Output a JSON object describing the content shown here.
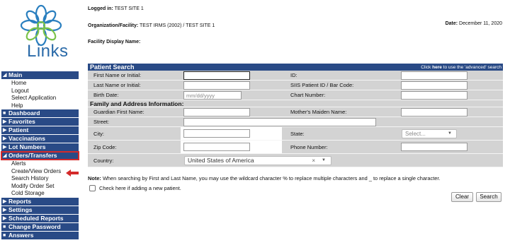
{
  "header": {
    "logged_in_label": "Logged in:",
    "logged_in_value": "TEST SITE 1",
    "org_label": "Organization/Facility:",
    "org_value": "TEST IRMS (2002) / TEST SITE 1",
    "facility_display_label": "Facility Display Name:",
    "date_label": "Date:",
    "date_value": "December 11, 2020"
  },
  "logo": {
    "text": "Links",
    "icon": "flower-logo"
  },
  "sidebar": {
    "sections": [
      {
        "label": "Main",
        "arrow": "◢",
        "items": [
          "Home",
          "Logout",
          "Select Application",
          "Help"
        ]
      },
      {
        "label": "Dashboard",
        "arrow": "■",
        "items": []
      },
      {
        "label": "Favorites",
        "arrow": "▶",
        "items": []
      },
      {
        "label": "Patient",
        "arrow": "▶",
        "items": []
      },
      {
        "label": "Vaccinations",
        "arrow": "▶",
        "items": []
      },
      {
        "label": "Lot Numbers",
        "arrow": "▶",
        "items": []
      },
      {
        "label": "Orders/Transfers",
        "arrow": "◢",
        "items": [
          "Alerts",
          "Create/View Orders",
          "Search History",
          "Modify Order Set",
          "Cold Storage"
        ]
      },
      {
        "label": "Reports",
        "arrow": "▶",
        "items": []
      },
      {
        "label": "Settings",
        "arrow": "▶",
        "items": []
      },
      {
        "label": "Scheduled Reports",
        "arrow": "▶",
        "items": []
      },
      {
        "label": "Change Password",
        "arrow": "■",
        "items": []
      },
      {
        "label": "Answers",
        "arrow": "■",
        "items": []
      }
    ]
  },
  "search": {
    "title": "Patient Search",
    "advanced_pre": "Click ",
    "advanced_link": "here",
    "advanced_post": " to use the 'advanced' search",
    "first_name_label": "First Name or Initial:",
    "id_label": "ID:",
    "last_name_label": "Last Name or Initial:",
    "siis_label": "SIIS Patient ID / Bar Code:",
    "birth_date_label": "Birth Date:",
    "birth_date_placeholder": "mm/dd/yyyy",
    "chart_number_label": "Chart Number:",
    "family_section": "Family and Address Information:",
    "guardian_label": "Guardian First Name:",
    "maiden_label": "Mother's Maiden Name:",
    "street_label": "Street:",
    "city_label": "City:",
    "state_label": "State:",
    "state_value": "Select...",
    "zip_label": "Zip Code:",
    "phone_label": "Phone Number:",
    "country_label": "Country:",
    "country_value": "United States of America",
    "country_clear": "×"
  },
  "note": {
    "label": "Note:",
    "text": "When searching by First and Last Name, you may use the wildcard character % to replace multiple characters and _ to replace a single character."
  },
  "new_patient_label": "Check here if adding a new patient.",
  "buttons": {
    "clear": "Clear",
    "search": "Search"
  },
  "colors": {
    "nav_bg": "#294a86",
    "form_grey": "#d3d3d3",
    "highlight": "#d42a2a"
  }
}
